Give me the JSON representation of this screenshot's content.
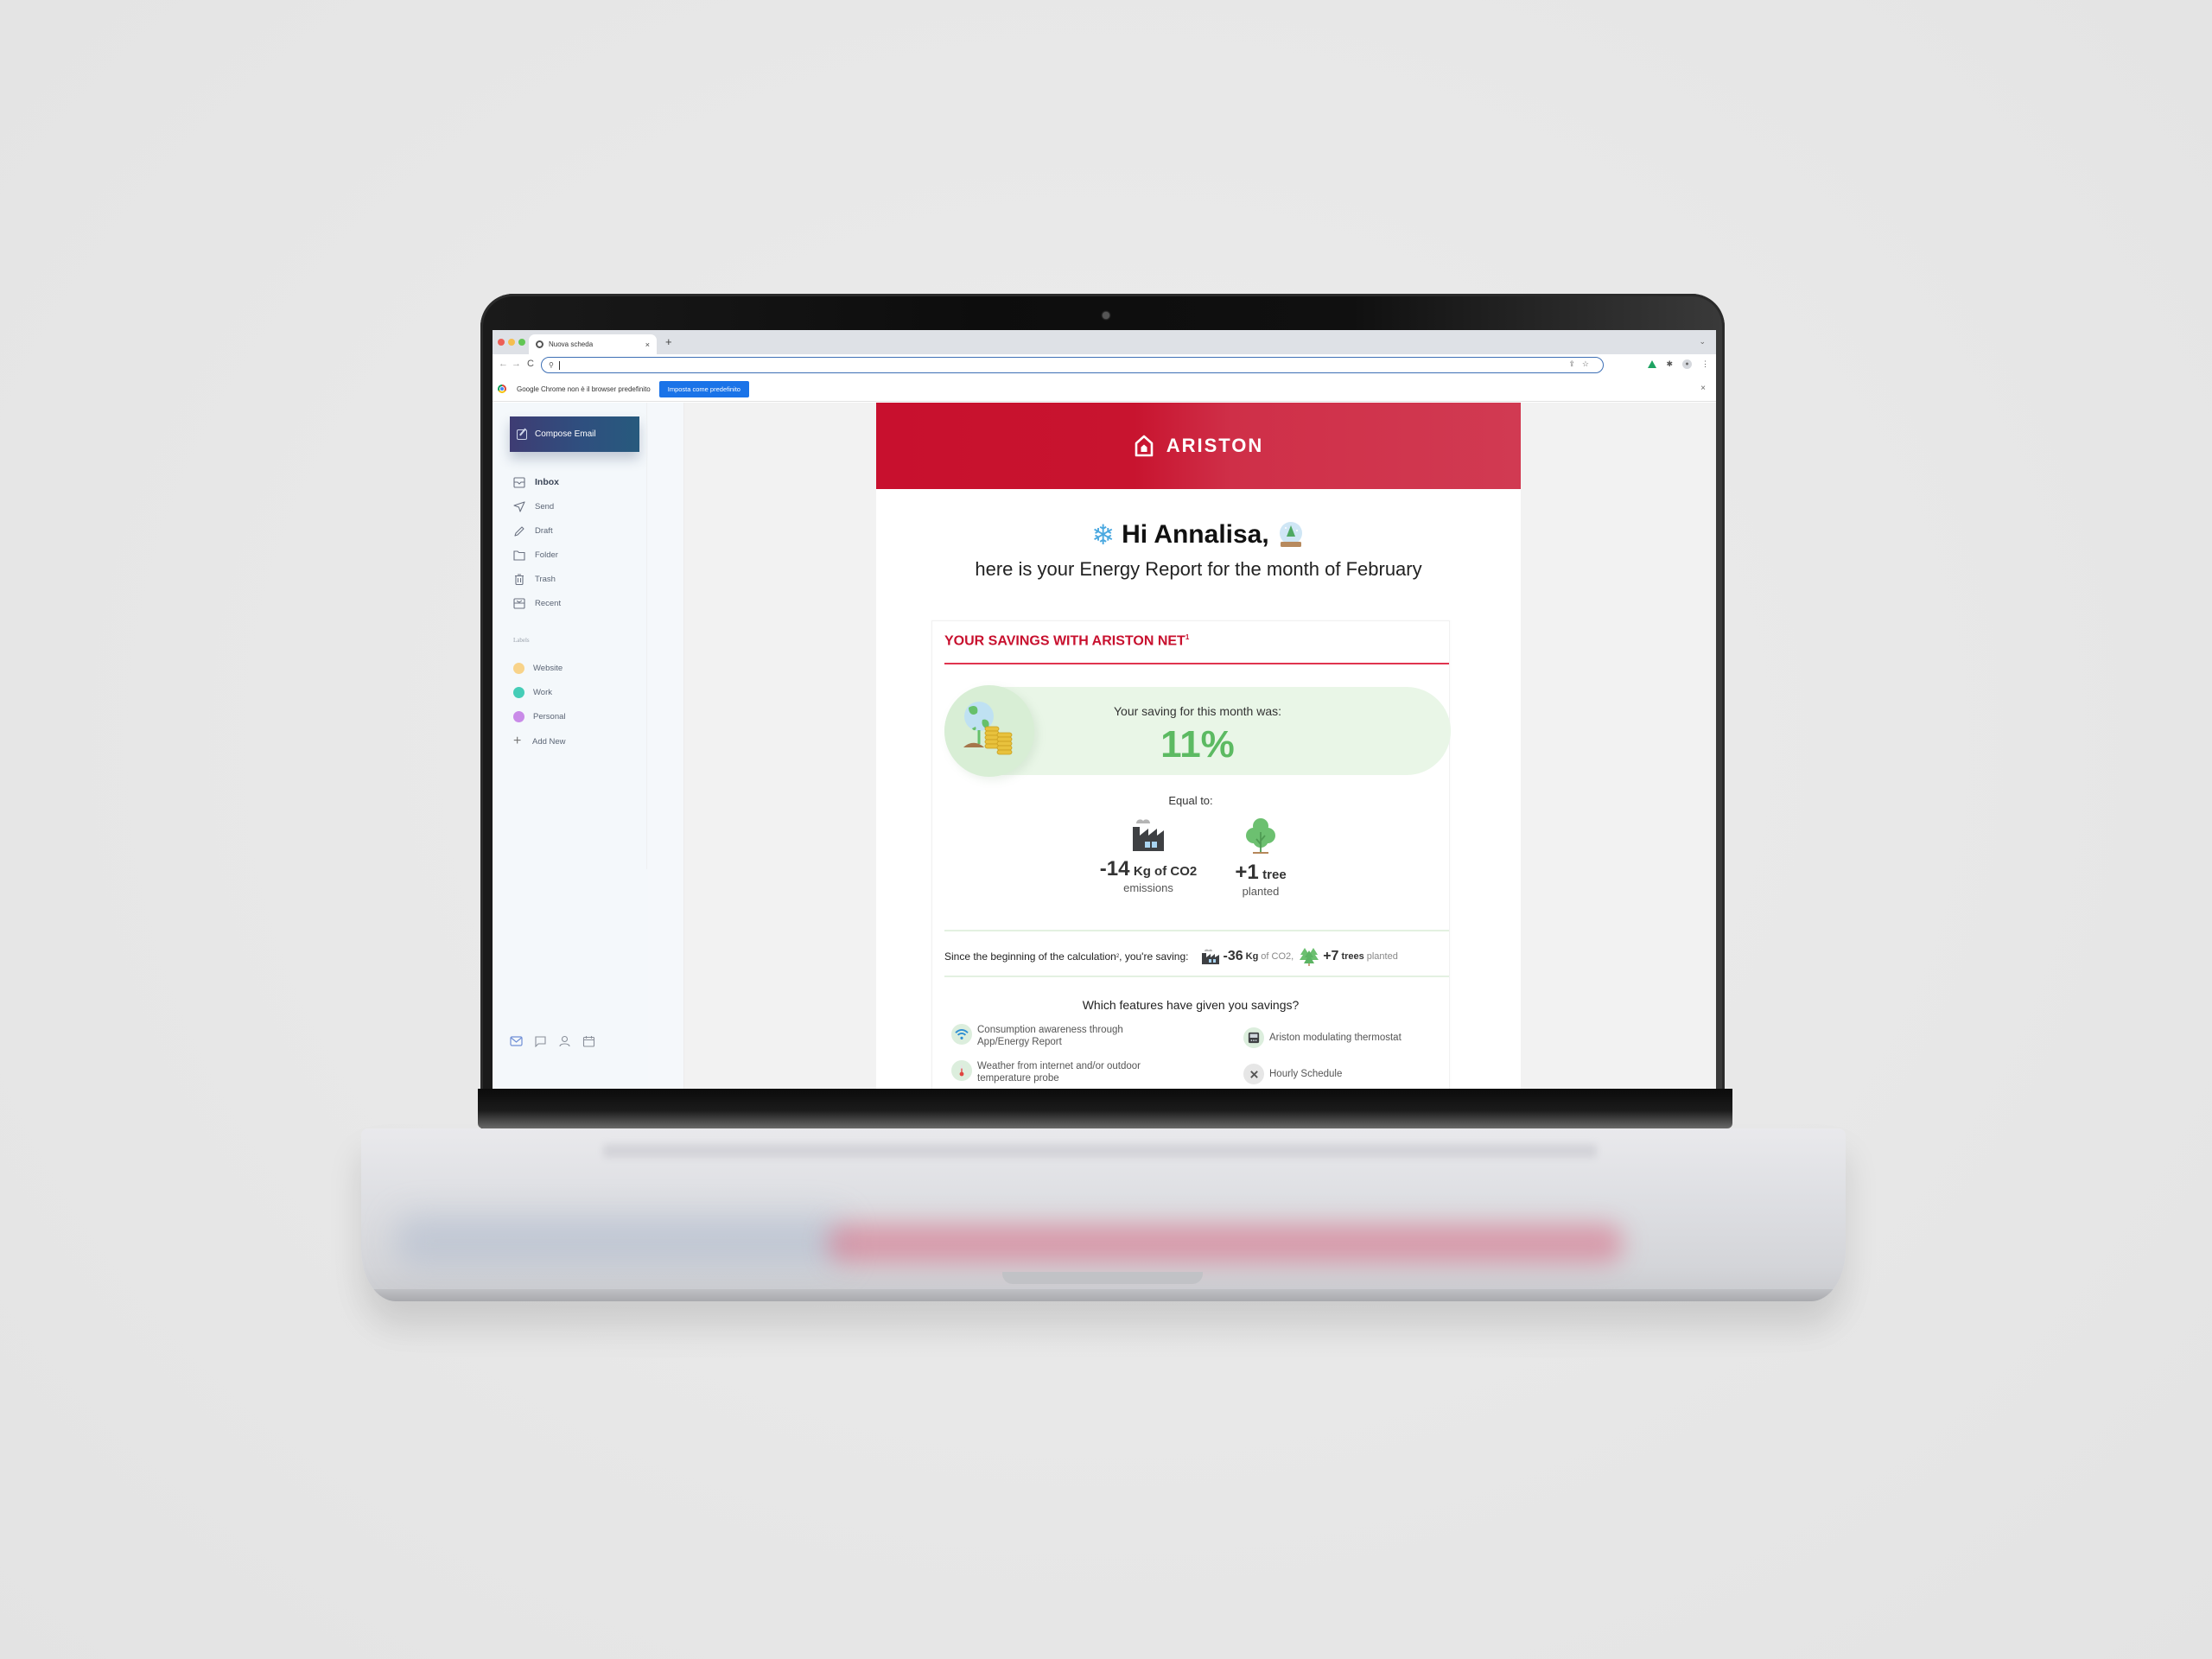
{
  "browser": {
    "tab_title": "Nuova scheda",
    "tab_close": "×",
    "new_tab": "+",
    "tab_menu": "⌄",
    "nav_back": "←",
    "nav_forward": "→",
    "nav_reload": "C",
    "address_value": "",
    "address_search_icon": "⚲",
    "omnibox_actions": "⇪☆",
    "infobar_message": "Google Chrome non è il browser predefinito",
    "infobar_button": "Imposta come predefinito",
    "infobar_close": "×",
    "extensions_icon": "✱",
    "profile_icon": "👤",
    "menu_icon": "⋮"
  },
  "sidebar": {
    "compose_label": "Compose Email",
    "nav_items": [
      {
        "label": "Inbox",
        "icon": "inbox-icon",
        "active": true
      },
      {
        "label": "Send",
        "icon": "send-icon"
      },
      {
        "label": "Draft",
        "icon": "pencil-icon"
      },
      {
        "label": "Folder",
        "icon": "folder-icon"
      },
      {
        "label": "Trash",
        "icon": "trash-icon"
      },
      {
        "label": "Recent",
        "icon": "recent-icon"
      }
    ],
    "labels_heading": "Labels",
    "labels": [
      {
        "label": "Website",
        "color": "#f8d38a"
      },
      {
        "label": "Work",
        "color": "#45cdb7"
      },
      {
        "label": "Personal",
        "color": "#c98be8"
      }
    ],
    "add_new": "Add New",
    "add_new_icon": "+"
  },
  "email": {
    "brand_name": "ARISTON",
    "brand_color": "#c8102e",
    "greeting": "Hi Annalisa,",
    "greeting_emoji_left": "❄",
    "subtitle": "here is your Energy Report for the month of February",
    "savings": {
      "title": "YOUR SAVINGS WITH ARISTON NET",
      "title_footnote": "1",
      "month_label": "Your saving for this month was:",
      "month_value": "11%",
      "equal_to": "Equal to:",
      "co2_value": "-14",
      "co2_unit": "Kg of CO2",
      "co2_sub": "emissions",
      "tree_value": "+1",
      "tree_unit": "tree",
      "tree_sub": "planted",
      "since_label": "Since the beginning of the calculation",
      "since_footnote": "2",
      "since_suffix": ", you're saving:",
      "since_co2_value": "-36",
      "since_co2_unit": "Kg",
      "since_co2_tail": "of CO2,",
      "since_tree_value": "+7",
      "since_tree_unit": "trees",
      "since_tree_tail": "planted",
      "accent_green": "#5cba62"
    },
    "features": {
      "title": "Which features have given you savings?",
      "items": [
        {
          "label": "Consumption awareness through App/Energy Report",
          "icon": "wifi-icon",
          "active": true
        },
        {
          "label": "Ariston modulating thermostat",
          "icon": "thermostat-icon",
          "active": true
        },
        {
          "label": "Weather from internet and/or outdoor temperature probe",
          "icon": "thermometer-icon",
          "active": true
        },
        {
          "label": "Hourly Schedule",
          "icon": "x-icon",
          "active": false
        }
      ]
    }
  }
}
